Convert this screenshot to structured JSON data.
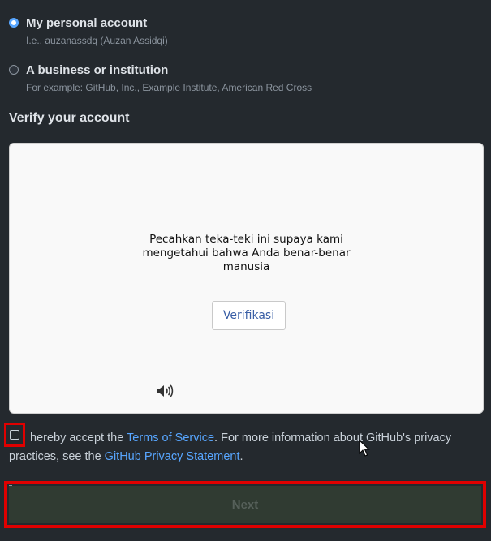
{
  "account_type": {
    "personal": {
      "label": "My personal account",
      "hint": "I.e., auzanassdq (Auzan Assidqi)",
      "selected": true
    },
    "business": {
      "label": "A business or institution",
      "hint": "For example: GitHub, Inc., Example Institute, American Red Cross",
      "selected": false
    }
  },
  "verify": {
    "heading": "Verify your account",
    "captcha_line1": "Pecahkan teka-teki ini supaya kami",
    "captcha_line2": "mengetahui bahwa Anda benar-benar",
    "captcha_line3": "manusia",
    "verify_button": "Verifikasi",
    "audio_icon": "speaker-icon"
  },
  "terms": {
    "checked": false,
    "prefix": "hereby accept the ",
    "tos_link": "Terms of Service",
    "middle": ". For more information about GitHub's privacy practices, see the ",
    "privacy_link": "GitHub Privacy Statement",
    "suffix": "."
  },
  "next_button": {
    "label": "Next",
    "enabled": false
  },
  "colors": {
    "background": "#24292e",
    "link": "#58a6ff",
    "highlight": "#e00000",
    "next_disabled": "#303b32"
  }
}
